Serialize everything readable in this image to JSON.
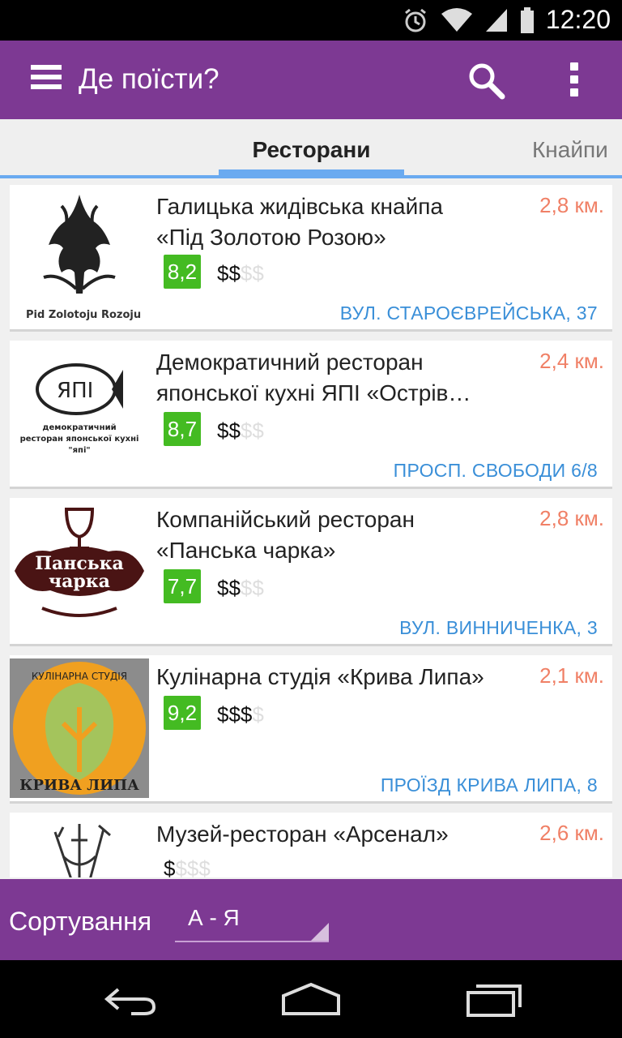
{
  "status": {
    "time": "12:20"
  },
  "appbar": {
    "title": "Де поїсти?"
  },
  "tabs": [
    {
      "label": "Ресторани"
    },
    {
      "label": "Кнайпи"
    }
  ],
  "restaurants": [
    {
      "name_lines": [
        "Галицька жидівська кнайпа",
        "«Під Золотою Розою»"
      ],
      "distance": "2,8 км.",
      "rating": "8,2",
      "price_active": "$$",
      "price_inactive": "$$",
      "address": "ВУЛ. СТАРОЄВРЕЙСЬКА, 37",
      "logo_text": "Pid Zolotoju Rozoju"
    },
    {
      "name_lines": [
        "Демократичний ресторан",
        "японської кухні ЯПІ «Острів…"
      ],
      "distance": "2,4 км.",
      "rating": "8,7",
      "price_active": "$$",
      "price_inactive": "$$",
      "address": "ПРОСП. СВОБОДИ 6/8",
      "logo_text_lines": [
        "демократичний",
        "ресторан японської кухні",
        "\"япі\""
      ],
      "logo_fish_text": "ЯПІ"
    },
    {
      "name_lines": [
        "Компанійський ресторан",
        "«Панська чарка»"
      ],
      "distance": "2,8 км.",
      "rating": "7,7",
      "price_active": "$$",
      "price_inactive": "$$",
      "address": "ВУЛ. ВИННИЧЕНКА, 3",
      "logo_text_lines": [
        "Панська",
        "чарка"
      ]
    },
    {
      "name_lines": [
        "Кулінарна студія «Крива Липа»"
      ],
      "distance": "2,1 км.",
      "rating": "9,2",
      "price_active": "$$$",
      "price_inactive": "$",
      "address": "ПРОЇЗД КРИВА ЛИПА, 8",
      "logo_text_top": "КУЛІНАРНА СТУДІЯ",
      "logo_text_bottom": "КРИВА ЛИПА"
    },
    {
      "name_lines": [
        "Музей-ресторан «Арсенал»"
      ],
      "distance": "2,6 км.",
      "rating": "",
      "price_active": "$",
      "price_inactive": "$$$",
      "address": ""
    }
  ],
  "sort": {
    "label": "Сортування",
    "value": "А - Я"
  },
  "colors": {
    "primary": "#7d3993",
    "accent": "#6aaaf0",
    "rating": "#44bb22",
    "distance": "#f08066",
    "address": "#3a8fd8"
  }
}
